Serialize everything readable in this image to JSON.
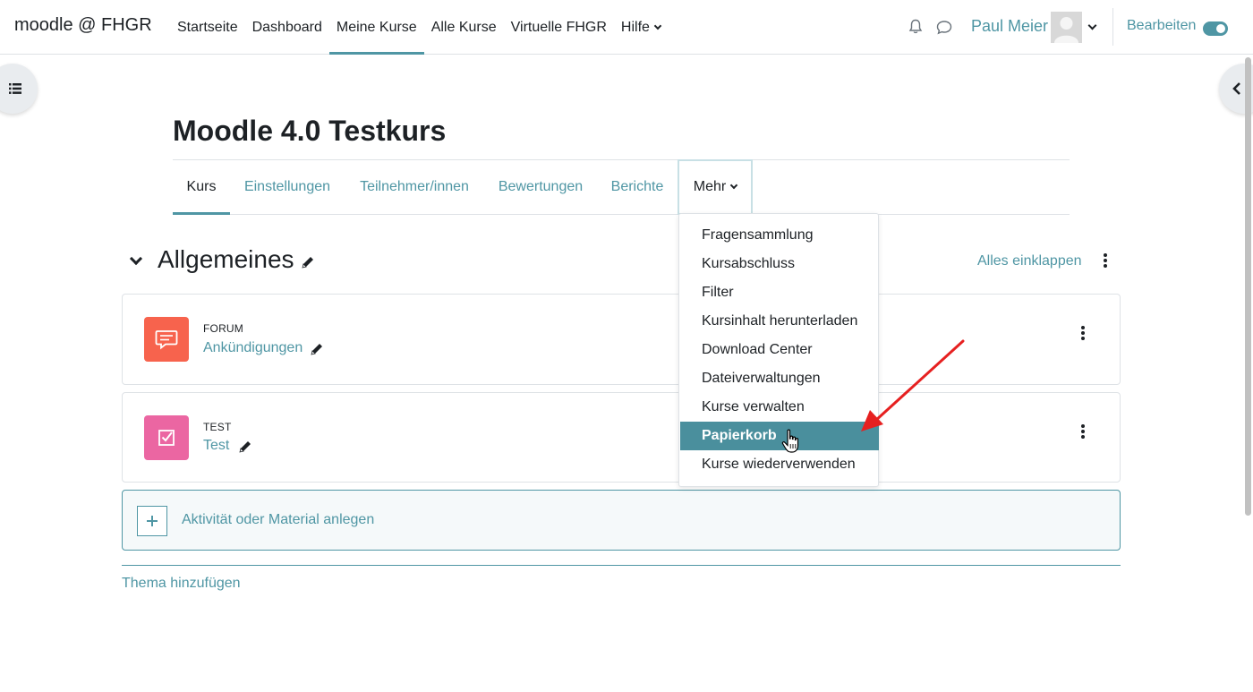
{
  "navbar": {
    "brand": "moodle @ FHGR",
    "items": [
      {
        "label": "Startseite"
      },
      {
        "label": "Dashboard"
      },
      {
        "label": "Meine Kurse"
      },
      {
        "label": "Alle Kurse"
      },
      {
        "label": "Virtuelle FHGR"
      },
      {
        "label": "Hilfe"
      }
    ],
    "username": "Paul Meier",
    "edit_label": "Bearbeiten"
  },
  "course": {
    "title": "Moodle 4.0 Testkurs",
    "tabs": [
      {
        "label": "Kurs"
      },
      {
        "label": "Einstellungen"
      },
      {
        "label": "Teilnehmer/innen"
      },
      {
        "label": "Bewertungen"
      },
      {
        "label": "Berichte"
      },
      {
        "label": "Mehr"
      }
    ]
  },
  "more_menu": {
    "items": [
      {
        "label": "Fragensammlung"
      },
      {
        "label": "Kursabschluss"
      },
      {
        "label": "Filter"
      },
      {
        "label": "Kursinhalt herunterladen"
      },
      {
        "label": "Download Center"
      },
      {
        "label": "Dateiverwaltungen"
      },
      {
        "label": "Kurse verwalten"
      },
      {
        "label": "Papierkorb"
      },
      {
        "label": "Kurse wiederverwenden"
      }
    ],
    "selected": "Papierkorb"
  },
  "section": {
    "title": "Allgemeines",
    "collapse_all": "Alles einklappen",
    "activities": [
      {
        "type": "FORUM",
        "name": "Ankündigungen",
        "color": "#f7634d"
      },
      {
        "type": "TEST",
        "name": "Test",
        "color": "#eb66a2"
      }
    ],
    "add_activity": "Aktivität oder Material anlegen",
    "add_topic": "Thema hinzufügen"
  },
  "colors": {
    "accent": "#4f96a4",
    "highlight": "#4a8f9d",
    "annotation_arrow": "#e62020"
  }
}
